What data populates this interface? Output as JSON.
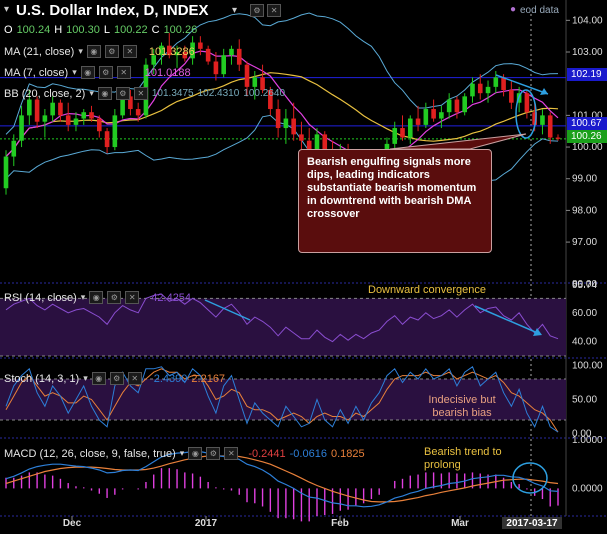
{
  "header": {
    "title": "U.S. Dollar Index, D, INDEX",
    "eod_label": "eod data",
    "ohlc": {
      "o_label": "O",
      "o": "100.24",
      "h_label": "H",
      "h": "100.30",
      "l_label": "L",
      "l": "100.22",
      "c_label": "C",
      "c": "100.26"
    }
  },
  "indicators": {
    "ma21": {
      "label": "MA (21, close)",
      "value": "101.3286"
    },
    "ma7": {
      "label": "MA (7, close)",
      "value": "101.0188"
    },
    "bb": {
      "label": "BB (20, close, 2)",
      "v1": "101.3475",
      "v2": "102.4310",
      "v3": "100.2640"
    },
    "rsi": {
      "label": "RSI (14, close)",
      "value": "42.4254"
    },
    "stoch": {
      "label": "Stoch (14, 3, 1)",
      "v1": "2.4390",
      "v2": "2.2167"
    },
    "macd": {
      "label": "MACD (12, 26, close, 9, false, true)",
      "v1": "-0.2441",
      "v2": "-0.0616",
      "v3": "0.1825"
    }
  },
  "annotations": {
    "note": "Bearish engulfing signals more dips, leading indicators substantiate bearish momentum in downtrend with bearish DMA crossover",
    "rsi_note": "Downward convergence",
    "stoch_note": "Indecisive but bearish bias",
    "macd_note": "Bearish trend to prolong"
  },
  "price_tags": {
    "upper": "102.19",
    "mid": "100.67",
    "last": "100.26"
  },
  "colors": {
    "up": "#22cc22",
    "down": "#e02020",
    "ma21": "#e8c040",
    "ma7": "#e040e0",
    "bb": "#5aaad6",
    "blue_line": "#2020e0",
    "rsi": "#8a4dd0",
    "stoch_k": "#2d7fd8",
    "stoch_d": "#e8803a",
    "macd": "#2d7fd8",
    "signal": "#e8803a",
    "hist": "#e040e0"
  },
  "chart_data": [
    {
      "type": "candlestick",
      "title": "U.S. Dollar Index, D, INDEX",
      "x_ticks": [
        "Dec",
        "2017",
        "Feb",
        "Mar",
        "2017-03-17"
      ],
      "ylim": [
        95.74,
        104.2
      ],
      "y_ticks": [
        97.0,
        98.0,
        99.0,
        100.0,
        101.0,
        103.0,
        104.0
      ],
      "axis_tags": [
        "102.19",
        "100.67",
        "100.26"
      ],
      "candles": [
        [
          98.7,
          99.9,
          98.5,
          99.7
        ],
        [
          99.7,
          100.4,
          99.4,
          100.2
        ],
        [
          100.2,
          101.3,
          100.0,
          101.0
        ],
        [
          101.0,
          101.8,
          100.7,
          101.5
        ],
        [
          101.5,
          101.6,
          100.6,
          100.8
        ],
        [
          100.8,
          101.2,
          100.3,
          101.0
        ],
        [
          101.0,
          101.6,
          100.8,
          101.4
        ],
        [
          101.4,
          101.5,
          100.8,
          101.0
        ],
        [
          101.0,
          101.4,
          100.5,
          100.7
        ],
        [
          100.7,
          101.1,
          100.5,
          100.9
        ],
        [
          100.9,
          101.2,
          100.7,
          101.1
        ],
        [
          101.1,
          101.3,
          100.8,
          100.9
        ],
        [
          100.9,
          101.0,
          100.3,
          100.5
        ],
        [
          100.5,
          100.6,
          99.8,
          100.0
        ],
        [
          100.0,
          101.2,
          99.9,
          101.0
        ],
        [
          101.0,
          101.8,
          100.9,
          101.6
        ],
        [
          101.6,
          101.8,
          101.0,
          101.2
        ],
        [
          101.2,
          101.4,
          100.8,
          101.0
        ],
        [
          101.0,
          102.8,
          100.9,
          102.6
        ],
        [
          102.6,
          103.1,
          102.3,
          102.9
        ],
        [
          102.9,
          103.3,
          102.6,
          103.2
        ],
        [
          103.2,
          103.6,
          102.8,
          102.9
        ],
        [
          102.9,
          103.2,
          102.5,
          103.0
        ],
        [
          103.0,
          103.2,
          102.7,
          102.8
        ],
        [
          102.8,
          103.5,
          102.6,
          103.3
        ],
        [
          103.3,
          103.5,
          102.9,
          103.1
        ],
        [
          103.1,
          103.2,
          102.6,
          102.7
        ],
        [
          102.7,
          103.0,
          102.1,
          102.3
        ],
        [
          102.3,
          103.1,
          102.2,
          102.9
        ],
        [
          102.9,
          103.2,
          102.6,
          103.1
        ],
        [
          103.1,
          103.4,
          102.4,
          102.6
        ],
        [
          102.6,
          102.7,
          101.6,
          101.9
        ],
        [
          101.9,
          102.4,
          101.5,
          102.2
        ],
        [
          102.2,
          102.6,
          101.7,
          101.8
        ],
        [
          101.8,
          101.9,
          101.0,
          101.2
        ],
        [
          101.2,
          101.5,
          100.3,
          100.6
        ],
        [
          100.6,
          101.2,
          100.1,
          100.9
        ],
        [
          100.9,
          101.4,
          100.2,
          100.4
        ],
        [
          100.4,
          100.8,
          99.8,
          100.2
        ],
        [
          100.2,
          100.6,
          99.7,
          99.9
        ],
        [
          99.9,
          100.6,
          99.7,
          100.4
        ],
        [
          100.4,
          100.5,
          99.6,
          99.8
        ],
        [
          99.8,
          100.2,
          99.4,
          99.6
        ],
        [
          99.6,
          100.1,
          99.3,
          99.9
        ],
        [
          99.9,
          100.1,
          99.3,
          99.4
        ],
        [
          99.4,
          99.9,
          99.1,
          99.7
        ],
        [
          99.7,
          99.9,
          99.0,
          99.3
        ],
        [
          99.3,
          99.7,
          98.9,
          99.5
        ],
        [
          99.5,
          99.8,
          99.2,
          99.6
        ],
        [
          99.6,
          100.3,
          99.5,
          100.1
        ],
        [
          100.1,
          100.8,
          99.9,
          100.6
        ],
        [
          100.6,
          101.0,
          100.2,
          100.3
        ],
        [
          100.3,
          101.0,
          100.1,
          100.9
        ],
        [
          100.9,
          101.3,
          100.5,
          100.7
        ],
        [
          100.7,
          101.4,
          100.6,
          101.2
        ],
        [
          101.2,
          101.5,
          100.8,
          100.9
        ],
        [
          100.9,
          101.3,
          100.6,
          101.1
        ],
        [
          101.1,
          101.7,
          100.9,
          101.5
        ],
        [
          101.5,
          101.6,
          100.9,
          101.1
        ],
        [
          101.1,
          101.7,
          101.0,
          101.6
        ],
        [
          101.6,
          102.2,
          101.4,
          102.0
        ],
        [
          102.0,
          102.3,
          101.5,
          101.7
        ],
        [
          101.7,
          102.1,
          101.4,
          101.9
        ],
        [
          101.9,
          102.4,
          101.7,
          102.2
        ],
        [
          102.2,
          102.3,
          101.6,
          101.8
        ],
        [
          101.8,
          102.1,
          101.2,
          101.4
        ],
        [
          101.4,
          101.9,
          101.1,
          101.7
        ],
        [
          101.7,
          101.8,
          100.9,
          101.1
        ],
        [
          101.1,
          101.4,
          100.5,
          100.7
        ],
        [
          100.7,
          101.2,
          100.4,
          101.0
        ],
        [
          101.0,
          101.1,
          100.1,
          100.3
        ],
        [
          100.3,
          100.4,
          100.2,
          100.26
        ]
      ]
    },
    {
      "type": "line",
      "title": "RSI (14, close)",
      "ylim": [
        30,
        80
      ],
      "y_ticks": [
        40.0,
        60.0,
        80.0
      ],
      "guides": [
        70,
        30
      ],
      "values": [
        62,
        66,
        68,
        70,
        65,
        62,
        66,
        63,
        60,
        62,
        63,
        60,
        57,
        52,
        60,
        65,
        62,
        60,
        70,
        72,
        73,
        68,
        70,
        66,
        70,
        67,
        62,
        57,
        63,
        66,
        60,
        52,
        57,
        54,
        50,
        44,
        50,
        46,
        42,
        42,
        48,
        43,
        40,
        45,
        41,
        45,
        42,
        46,
        48,
        54,
        58,
        52,
        57,
        55,
        60,
        56,
        58,
        62,
        57,
        62,
        66,
        60,
        63,
        64,
        58,
        55,
        60,
        52,
        46,
        52,
        44,
        42
      ]
    },
    {
      "type": "line",
      "title": "Stoch (14, 3, 1)",
      "ylim": [
        0,
        100
      ],
      "y_ticks": [
        0.0,
        50.0,
        100.0
      ],
      "series": [
        {
          "name": "%K",
          "values": [
            40,
            70,
            85,
            95,
            60,
            40,
            70,
            55,
            30,
            50,
            70,
            40,
            20,
            10,
            70,
            90,
            70,
            60,
            95,
            95,
            98,
            85,
            90,
            75,
            95,
            85,
            55,
            30,
            70,
            85,
            50,
            15,
            45,
            30,
            20,
            10,
            40,
            25,
            10,
            15,
            50,
            20,
            10,
            35,
            15,
            40,
            20,
            45,
            60,
            85,
            95,
            75,
            90,
            80,
            95,
            80,
            85,
            95,
            70,
            90,
            98,
            70,
            80,
            90,
            60,
            40,
            65,
            30,
            10,
            40,
            10,
            2.4
          ]
        },
        {
          "name": "%D",
          "values": [
            35,
            55,
            75,
            85,
            70,
            55,
            60,
            55,
            45,
            45,
            55,
            50,
            35,
            20,
            40,
            60,
            75,
            70,
            80,
            90,
            95,
            90,
            90,
            80,
            85,
            85,
            70,
            50,
            55,
            65,
            60,
            40,
            35,
            35,
            30,
            20,
            25,
            30,
            25,
            15,
            25,
            30,
            25,
            25,
            20,
            30,
            25,
            35,
            45,
            65,
            80,
            85,
            85,
            85,
            90,
            85,
            85,
            90,
            80,
            85,
            90,
            85,
            80,
            85,
            75,
            60,
            55,
            45,
            35,
            30,
            20,
            2.2
          ]
        }
      ],
      "guides": [
        80,
        20
      ]
    },
    {
      "type": "line",
      "title": "MACD (12, 26, close, 9, false, true)",
      "ylim": [
        -0.55,
        1.0
      ],
      "y_ticks": [
        0.0,
        1.0
      ],
      "series": [
        {
          "name": "MACD",
          "values": [
            0.2,
            0.25,
            0.32,
            0.4,
            0.45,
            0.48,
            0.5,
            0.5,
            0.48,
            0.46,
            0.45,
            0.42,
            0.38,
            0.32,
            0.33,
            0.37,
            0.38,
            0.37,
            0.45,
            0.55,
            0.65,
            0.7,
            0.73,
            0.74,
            0.76,
            0.76,
            0.73,
            0.68,
            0.66,
            0.65,
            0.6,
            0.5,
            0.45,
            0.38,
            0.28,
            0.15,
            0.08,
            0.0,
            -0.1,
            -0.18,
            -0.2,
            -0.25,
            -0.3,
            -0.32,
            -0.36,
            -0.36,
            -0.38,
            -0.37,
            -0.34,
            -0.28,
            -0.2,
            -0.16,
            -0.1,
            -0.06,
            0.0,
            0.03,
            0.06,
            0.1,
            0.12,
            0.15,
            0.2,
            0.22,
            0.24,
            0.27,
            0.27,
            0.24,
            0.23,
            0.18,
            0.1,
            0.05,
            -0.05,
            -0.0616
          ]
        },
        {
          "name": "Signal",
          "values": [
            0.1,
            0.15,
            0.2,
            0.25,
            0.3,
            0.35,
            0.38,
            0.41,
            0.43,
            0.44,
            0.44,
            0.44,
            0.43,
            0.41,
            0.39,
            0.38,
            0.38,
            0.38,
            0.39,
            0.42,
            0.46,
            0.51,
            0.55,
            0.59,
            0.62,
            0.65,
            0.67,
            0.67,
            0.67,
            0.67,
            0.66,
            0.63,
            0.59,
            0.55,
            0.5,
            0.43,
            0.36,
            0.29,
            0.21,
            0.13,
            0.06,
            0.0,
            -0.06,
            -0.11,
            -0.16,
            -0.2,
            -0.24,
            -0.27,
            -0.28,
            -0.28,
            -0.27,
            -0.25,
            -0.22,
            -0.19,
            -0.15,
            -0.12,
            -0.08,
            -0.05,
            -0.02,
            0.01,
            0.05,
            0.08,
            0.11,
            0.14,
            0.17,
            0.18,
            0.19,
            0.19,
            0.17,
            0.15,
            0.12,
            0.1
          ]
        }
      ]
    }
  ]
}
